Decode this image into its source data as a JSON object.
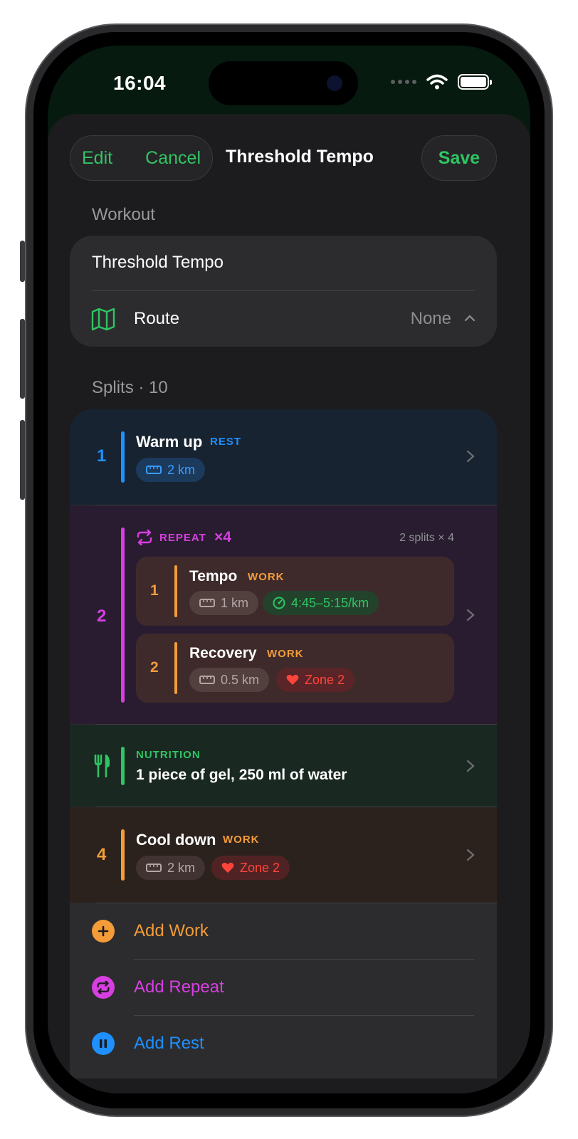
{
  "status_bar": {
    "time": "16:04"
  },
  "nav": {
    "edit_label": "Edit",
    "cancel_label": "Cancel",
    "title": "Threshold Tempo",
    "save_label": "Save"
  },
  "workout": {
    "section_label": "Workout",
    "name_value": "Threshold Tempo",
    "route_label": "Route",
    "route_value": "None"
  },
  "splits": {
    "section_label": "Splits · 10",
    "items": [
      {
        "number": "1",
        "title": "Warm up",
        "tag": "REST",
        "distance": "2 km"
      },
      {
        "number": "2",
        "repeat_label": "REPEAT",
        "repeat_count": "×4",
        "summary": "2 splits × 4",
        "children": [
          {
            "number": "1",
            "title": "Tempo",
            "tag": "WORK",
            "distance": "1 km",
            "pace": "4:45–5:15/km"
          },
          {
            "number": "2",
            "title": "Recovery",
            "tag": "WORK",
            "distance": "0.5 km",
            "zone": "Zone 2"
          }
        ]
      },
      {
        "tag": "NUTRITION",
        "text": "1 piece of gel, 250 ml of water"
      },
      {
        "number": "4",
        "title": "Cool down",
        "tag": "WORK",
        "distance": "2 km",
        "zone": "Zone 2"
      }
    ]
  },
  "actions": {
    "add_work": "Add Work",
    "add_repeat": "Add Repeat",
    "add_rest": "Add Rest"
  },
  "colors": {
    "accent_green": "#30c463",
    "rest_blue": "#1e90ff",
    "repeat_purple": "#d63fe0",
    "work_orange": "#f39c38",
    "zone_red": "#ff453a",
    "nutrition_green": "#30c463"
  },
  "icons": {
    "route": "map-icon",
    "distance": "ruler-icon",
    "pace": "speedometer-icon",
    "zone": "heart-icon",
    "repeat": "repeat-icon",
    "nutrition": "fork-knife-icon",
    "add_work": "plus-icon",
    "add_repeat": "repeat-icon",
    "add_rest": "pause-icon"
  }
}
